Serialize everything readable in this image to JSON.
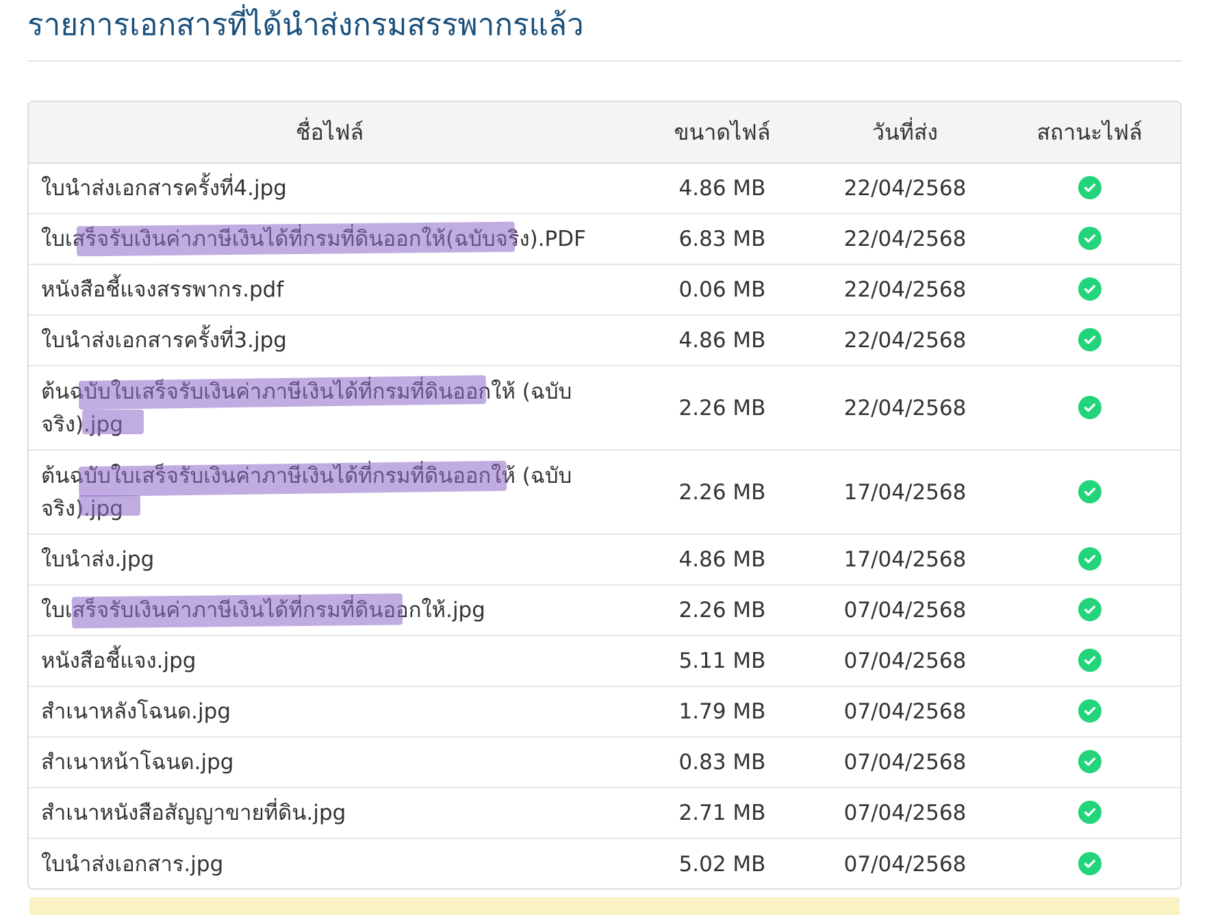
{
  "page": {
    "title": "รายการเอกสารที่ได้นำส่งกรมสรรพากรแล้ว"
  },
  "table": {
    "headers": {
      "name": "ชื่อไฟล์",
      "size": "ขนาดไฟล์",
      "date": "วันที่ส่ง",
      "status": "สถานะไฟล์"
    },
    "rows": [
      {
        "name": "ใบนำส่งเอกสารครั้งที่4.jpg",
        "size": "4.86 MB",
        "date": "22/04/2568",
        "status": "check-circle-icon"
      },
      {
        "name": "ใบเสร็จรับเงินค่าภาษีเงินได้ที่กรมที่ดินออกให้(ฉบับจริง).PDF",
        "size": "6.83 MB",
        "date": "22/04/2568",
        "status": "check-circle-icon"
      },
      {
        "name": "หนังสือชี้แจงสรรพากร.pdf",
        "size": "0.06 MB",
        "date": "22/04/2568",
        "status": "check-circle-icon"
      },
      {
        "name": "ใบนำส่งเอกสารครั้งที่3.jpg",
        "size": "4.86 MB",
        "date": "22/04/2568",
        "status": "check-circle-icon"
      },
      {
        "name": "ต้นฉบับใบเสร็จรับเงินค่าภาษีเงินได้ที่กรมที่ดินออกให้ (ฉบับจริง).jpg",
        "size": "2.26 MB",
        "date": "22/04/2568",
        "status": "check-circle-icon"
      },
      {
        "name": "ต้นฉบับใบเสร็จรับเงินค่าภาษีเงินได้ที่กรมที่ดินออกให้ (ฉบับจริง).jpg",
        "size": "2.26 MB",
        "date": "17/04/2568",
        "status": "check-circle-icon"
      },
      {
        "name": "ใบนำส่ง.jpg",
        "size": "4.86 MB",
        "date": "17/04/2568",
        "status": "check-circle-icon"
      },
      {
        "name": "ใบเสร็จรับเงินค่าภาษีเงินได้ที่กรมที่ดินออกให้.jpg",
        "size": "2.26 MB",
        "date": "07/04/2568",
        "status": "check-circle-icon"
      },
      {
        "name": "หนังสือชี้แจง.jpg",
        "size": "5.11 MB",
        "date": "07/04/2568",
        "status": "check-circle-icon"
      },
      {
        "name": "สำเนาหลังโฉนด.jpg",
        "size": "1.79 MB",
        "date": "07/04/2568",
        "status": "check-circle-icon"
      },
      {
        "name": "สำเนาหน้าโฉนด.jpg",
        "size": "0.83 MB",
        "date": "07/04/2568",
        "status": "check-circle-icon"
      },
      {
        "name": "สำเนาหนังสือสัญญาขายที่ดิน.jpg",
        "size": "2.71 MB",
        "date": "07/04/2568",
        "status": "check-circle-icon"
      },
      {
        "name": "ใบนำส่งเอกสาร.jpg",
        "size": "5.02 MB",
        "date": "07/04/2568",
        "status": "check-circle-icon"
      }
    ]
  },
  "colors": {
    "title": "#1a4f7a",
    "status_ok": "#22d47a",
    "header_bg": "#f4f4f4",
    "note_bg": "#fbf2c4",
    "highlight": "#8c68c8"
  }
}
